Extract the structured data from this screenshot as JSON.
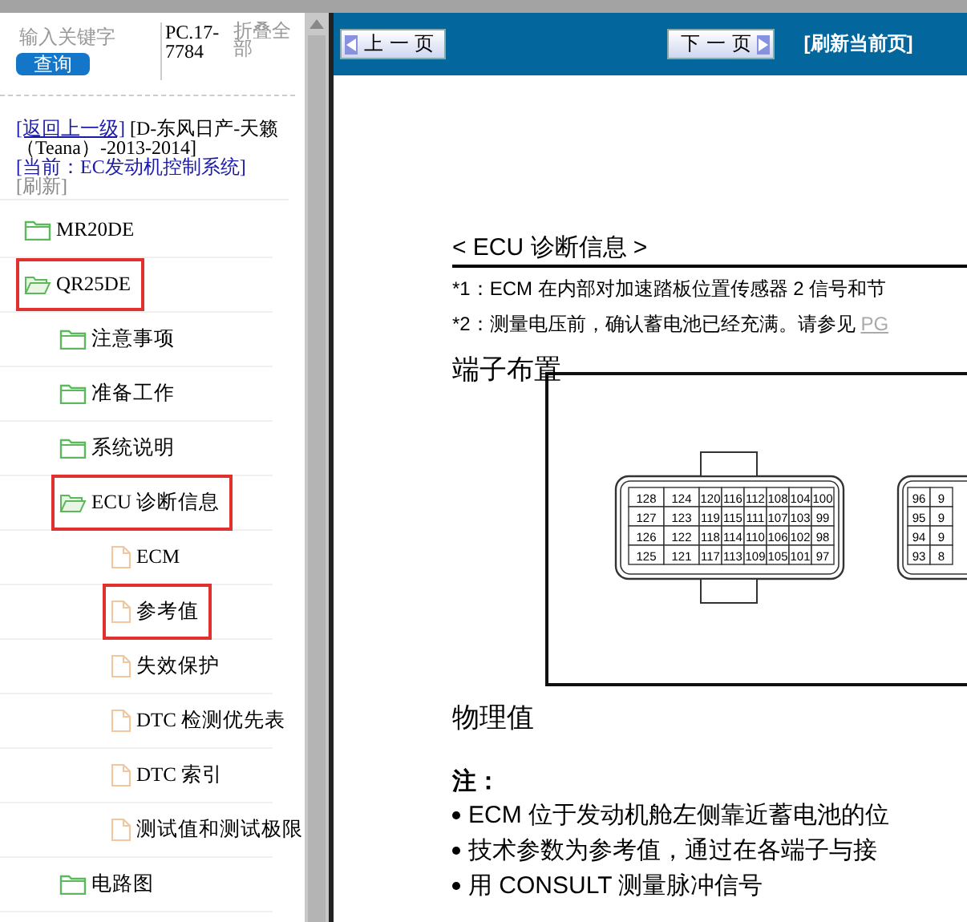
{
  "sidebar": {
    "search": {
      "placeholder": "输入关键字",
      "button": "查询"
    },
    "code": "PC.17-7784",
    "collapse_all": "折叠全部",
    "breadcrumb": {
      "back": "[返回上一级]",
      "path": "[D-东风日产-天籁（Teana）-2013-2014]",
      "current": "[当前：EC发动机控制系统]",
      "refresh": "[刷新]"
    },
    "tree": [
      {
        "label": "MR20DE",
        "kind": "folder",
        "expanded": false,
        "highlighted": false
      },
      {
        "label": "QR25DE",
        "kind": "folder",
        "expanded": true,
        "highlighted": true,
        "children": [
          {
            "label": "注意事项",
            "kind": "folder",
            "expanded": false,
            "highlighted": false
          },
          {
            "label": "准备工作",
            "kind": "folder",
            "expanded": false,
            "highlighted": false
          },
          {
            "label": "系统说明",
            "kind": "folder",
            "expanded": false,
            "highlighted": false
          },
          {
            "label": "ECU 诊断信息",
            "kind": "folder",
            "expanded": true,
            "highlighted": true,
            "children": [
              {
                "label": "ECM",
                "kind": "file",
                "highlighted": false
              },
              {
                "label": "参考值",
                "kind": "file",
                "highlighted": true
              },
              {
                "label": "失效保护",
                "kind": "file",
                "highlighted": false
              },
              {
                "label": "DTC 检测优先表",
                "kind": "file",
                "highlighted": false
              },
              {
                "label": "DTC 索引",
                "kind": "file",
                "highlighted": false
              },
              {
                "label": "测试值和测试极限",
                "kind": "file",
                "highlighted": false
              }
            ]
          },
          {
            "label": "电路图",
            "kind": "folder",
            "expanded": false,
            "highlighted": false
          }
        ]
      }
    ]
  },
  "toolbar": {
    "prev": "上 一 页",
    "next": "下 一 页",
    "refresh": "[刷新当前页]"
  },
  "document": {
    "title": "< ECU 诊断信息 >",
    "notes": [
      {
        "text": "*1：ECM 在内部对加速踏板位置传感器 2 信号和节"
      },
      {
        "text": "*2：测量电压前，确认蓄电池已经充满。请参见 ",
        "link": "PG"
      }
    ],
    "terminal_heading": "端子布置",
    "connectors": [
      {
        "pins": [
          [
            "128",
            "124",
            "120",
            "116",
            "112",
            "108",
            "104",
            "100"
          ],
          [
            "127",
            "123",
            "119",
            "115",
            "111",
            "107",
            "103",
            "99"
          ],
          [
            "126",
            "122",
            "118",
            "114",
            "110",
            "106",
            "102",
            "98"
          ],
          [
            "125",
            "121",
            "117",
            "113",
            "109",
            "105",
            "101",
            "97"
          ]
        ]
      },
      {
        "pins": [
          [
            "96",
            "9"
          ],
          [
            "95",
            "9"
          ],
          [
            "94",
            "9"
          ],
          [
            "93",
            "8"
          ]
        ]
      }
    ],
    "values_heading": "物理值",
    "note_label": "注：",
    "bullets": [
      "ECM 位于发动机舱左侧靠近蓄电池的位",
      "技术参数为参考值，通过在各端子与接",
      "用 CONSULT 测量脉冲信号"
    ]
  }
}
